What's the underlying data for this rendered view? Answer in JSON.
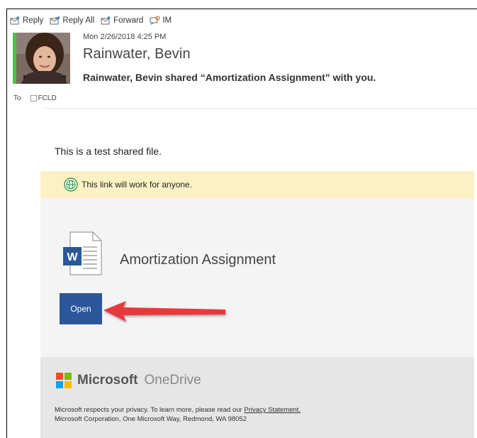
{
  "toolbar": {
    "reply": "Reply",
    "reply_all": "Reply All",
    "forward": "Forward",
    "im": "IM"
  },
  "message": {
    "date": "Mon 2/26/2018 4:25 PM",
    "sender": "Rainwater, Bevin",
    "subject": "Rainwater, Bevin shared “Amortization Assignment” with you.",
    "to_label": "To",
    "to_recipient": "FCLD",
    "body": "This is a test shared file."
  },
  "share_card": {
    "notice": "This link will work for anyone.",
    "file_name": "Amortization Assignment",
    "open_label": "Open",
    "file_icon_letter": "W"
  },
  "footer": {
    "brand_microsoft": "Microsoft",
    "brand_onedrive": "OneDrive",
    "privacy_text": "Microsoft respects your privacy. To learn more, please read our ",
    "privacy_link": "Privacy Statement.",
    "address": "Microsoft Corporation, One Microsoft Way, Redmond, WA 98052"
  },
  "colors": {
    "status_bar": "#4ec14a",
    "notice_bg": "#fcf1c4",
    "open_button": "#2b579a",
    "arrow": "#e8393a"
  }
}
